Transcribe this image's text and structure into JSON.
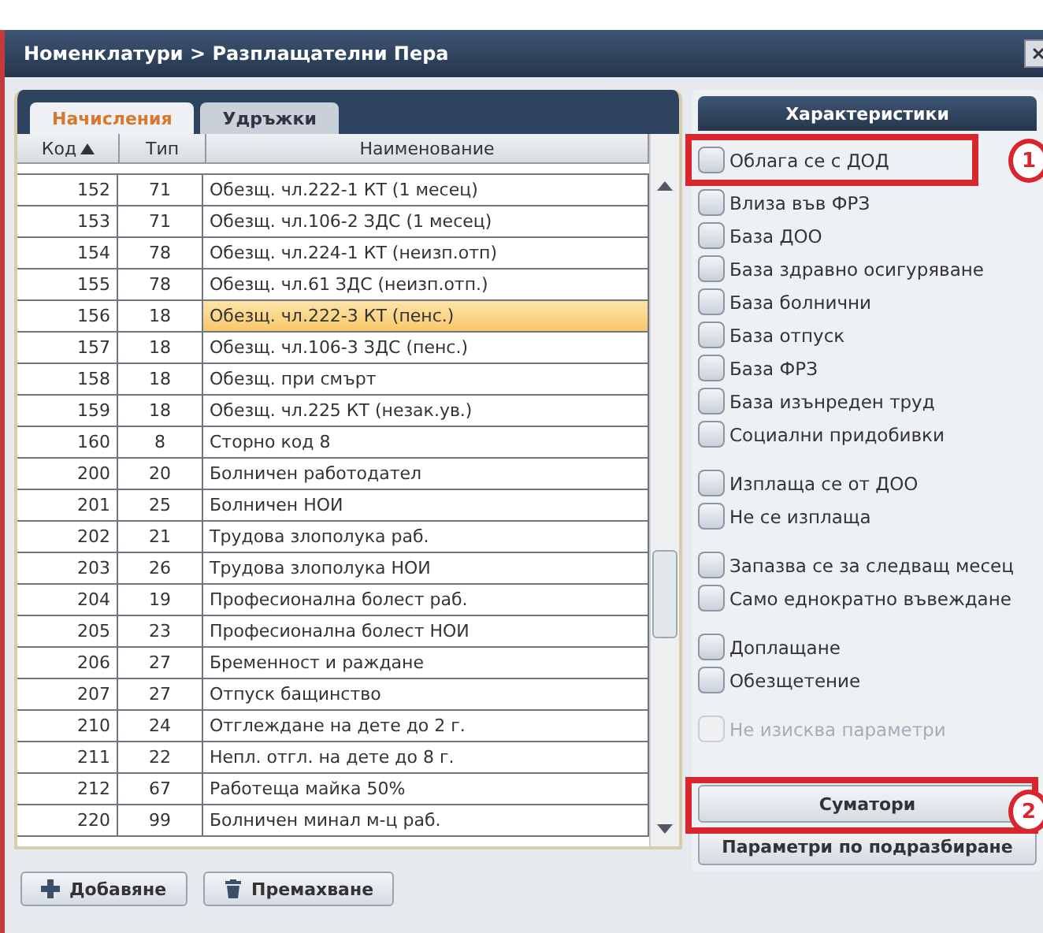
{
  "window": {
    "title": "Номенклатури > Разплащателни Пера",
    "close": "✕"
  },
  "tabs": [
    {
      "label": "Начисления",
      "selected": true
    },
    {
      "label": "Удръжки",
      "selected": false
    }
  ],
  "table": {
    "columns": [
      {
        "label": "Код",
        "sorted": true
      },
      {
        "label": "Тип",
        "sorted": false
      },
      {
        "label": "Наименование",
        "sorted": false
      }
    ],
    "rows": [
      {
        "code": "152",
        "type": "71",
        "name": "Обезщ. чл.222-1 КТ (1 месец)",
        "selected": false
      },
      {
        "code": "153",
        "type": "71",
        "name": "Обезщ. чл.106-2 ЗДС (1 месец)",
        "selected": false
      },
      {
        "code": "154",
        "type": "78",
        "name": "Обезщ. чл.224-1 КТ (неизп.отп)",
        "selected": false
      },
      {
        "code": "155",
        "type": "78",
        "name": "Обезщ. чл.61 ЗДС (неизп.отп.)",
        "selected": false
      },
      {
        "code": "156",
        "type": "18",
        "name": "Обезщ. чл.222-3 КТ (пенс.)",
        "selected": true
      },
      {
        "code": "157",
        "type": "18",
        "name": "Обезщ. чл.106-3 ЗДС (пенс.)",
        "selected": false
      },
      {
        "code": "158",
        "type": "18",
        "name": "Обезщ. при смърт",
        "selected": false
      },
      {
        "code": "159",
        "type": "18",
        "name": "Обезщ. чл.225 КТ (незак.ув.)",
        "selected": false
      },
      {
        "code": "160",
        "type": "8",
        "name": "Сторно код 8",
        "selected": false
      },
      {
        "code": "200",
        "type": "20",
        "name": "Болничен работодател",
        "selected": false
      },
      {
        "code": "201",
        "type": "25",
        "name": "Болничен НОИ",
        "selected": false
      },
      {
        "code": "202",
        "type": "21",
        "name": "Трудова злополука раб.",
        "selected": false
      },
      {
        "code": "203",
        "type": "26",
        "name": "Трудова злополука НОИ",
        "selected": false
      },
      {
        "code": "204",
        "type": "19",
        "name": "Професионална болест раб.",
        "selected": false
      },
      {
        "code": "205",
        "type": "23",
        "name": "Професионална болест НОИ",
        "selected": false
      },
      {
        "code": "206",
        "type": "27",
        "name": "Бременност и раждане",
        "selected": false
      },
      {
        "code": "207",
        "type": "27",
        "name": "Отпуск бащинство",
        "selected": false
      },
      {
        "code": "210",
        "type": "24",
        "name": "Отглеждане на дете до 2 г.",
        "selected": false
      },
      {
        "code": "211",
        "type": "22",
        "name": "Непл. отгл. на дете до 8 г.",
        "selected": false
      },
      {
        "code": "212",
        "type": "67",
        "name": "Работеща майка 50%",
        "selected": false
      },
      {
        "code": "220",
        "type": "99",
        "name": "Болничен минал м-ц раб.",
        "selected": false
      }
    ]
  },
  "buttons": [
    {
      "label": "Добавяне",
      "kind": "add"
    },
    {
      "label": "Премахване",
      "kind": "remove"
    }
  ],
  "characteristics": {
    "title": "Характеристики",
    "groups": [
      {
        "items": [
          {
            "label": "Облага се с ДОД",
            "checked": false,
            "disabled": false
          },
          {
            "label": "Влиза във ФРЗ",
            "checked": false,
            "disabled": false
          },
          {
            "label": "База ДОО",
            "checked": false,
            "disabled": false
          },
          {
            "label": "База здравно осигуряване",
            "checked": false,
            "disabled": false
          },
          {
            "label": "База болнични",
            "checked": false,
            "disabled": false
          },
          {
            "label": "База отпуск",
            "checked": false,
            "disabled": false
          },
          {
            "label": "База ФРЗ",
            "checked": false,
            "disabled": false
          },
          {
            "label": "База изънреден труд",
            "checked": false,
            "disabled": false
          },
          {
            "label": "Социални придобивки",
            "checked": false,
            "disabled": false
          }
        ]
      },
      {
        "items": [
          {
            "label": "Изплаща се от ДОО",
            "checked": false,
            "disabled": false
          },
          {
            "label": "Не се изплаща",
            "checked": false,
            "disabled": false
          }
        ]
      },
      {
        "items": [
          {
            "label": "Запазва се за следващ месец",
            "checked": false,
            "disabled": false
          },
          {
            "label": "Само еднократно въвеждане",
            "checked": false,
            "disabled": false
          }
        ]
      },
      {
        "items": [
          {
            "label": "Доплащане",
            "checked": false,
            "disabled": false
          },
          {
            "label": "Обезщетение",
            "checked": false,
            "disabled": false
          }
        ]
      },
      {
        "items": [
          {
            "label": "Не изисква параметри",
            "checked": false,
            "disabled": true
          }
        ]
      }
    ],
    "buttons": [
      {
        "label": "Суматори"
      },
      {
        "label": "Параметри по подразбиране"
      }
    ]
  },
  "annotations": [
    {
      "label": "1"
    },
    {
      "label": "2"
    }
  ]
}
